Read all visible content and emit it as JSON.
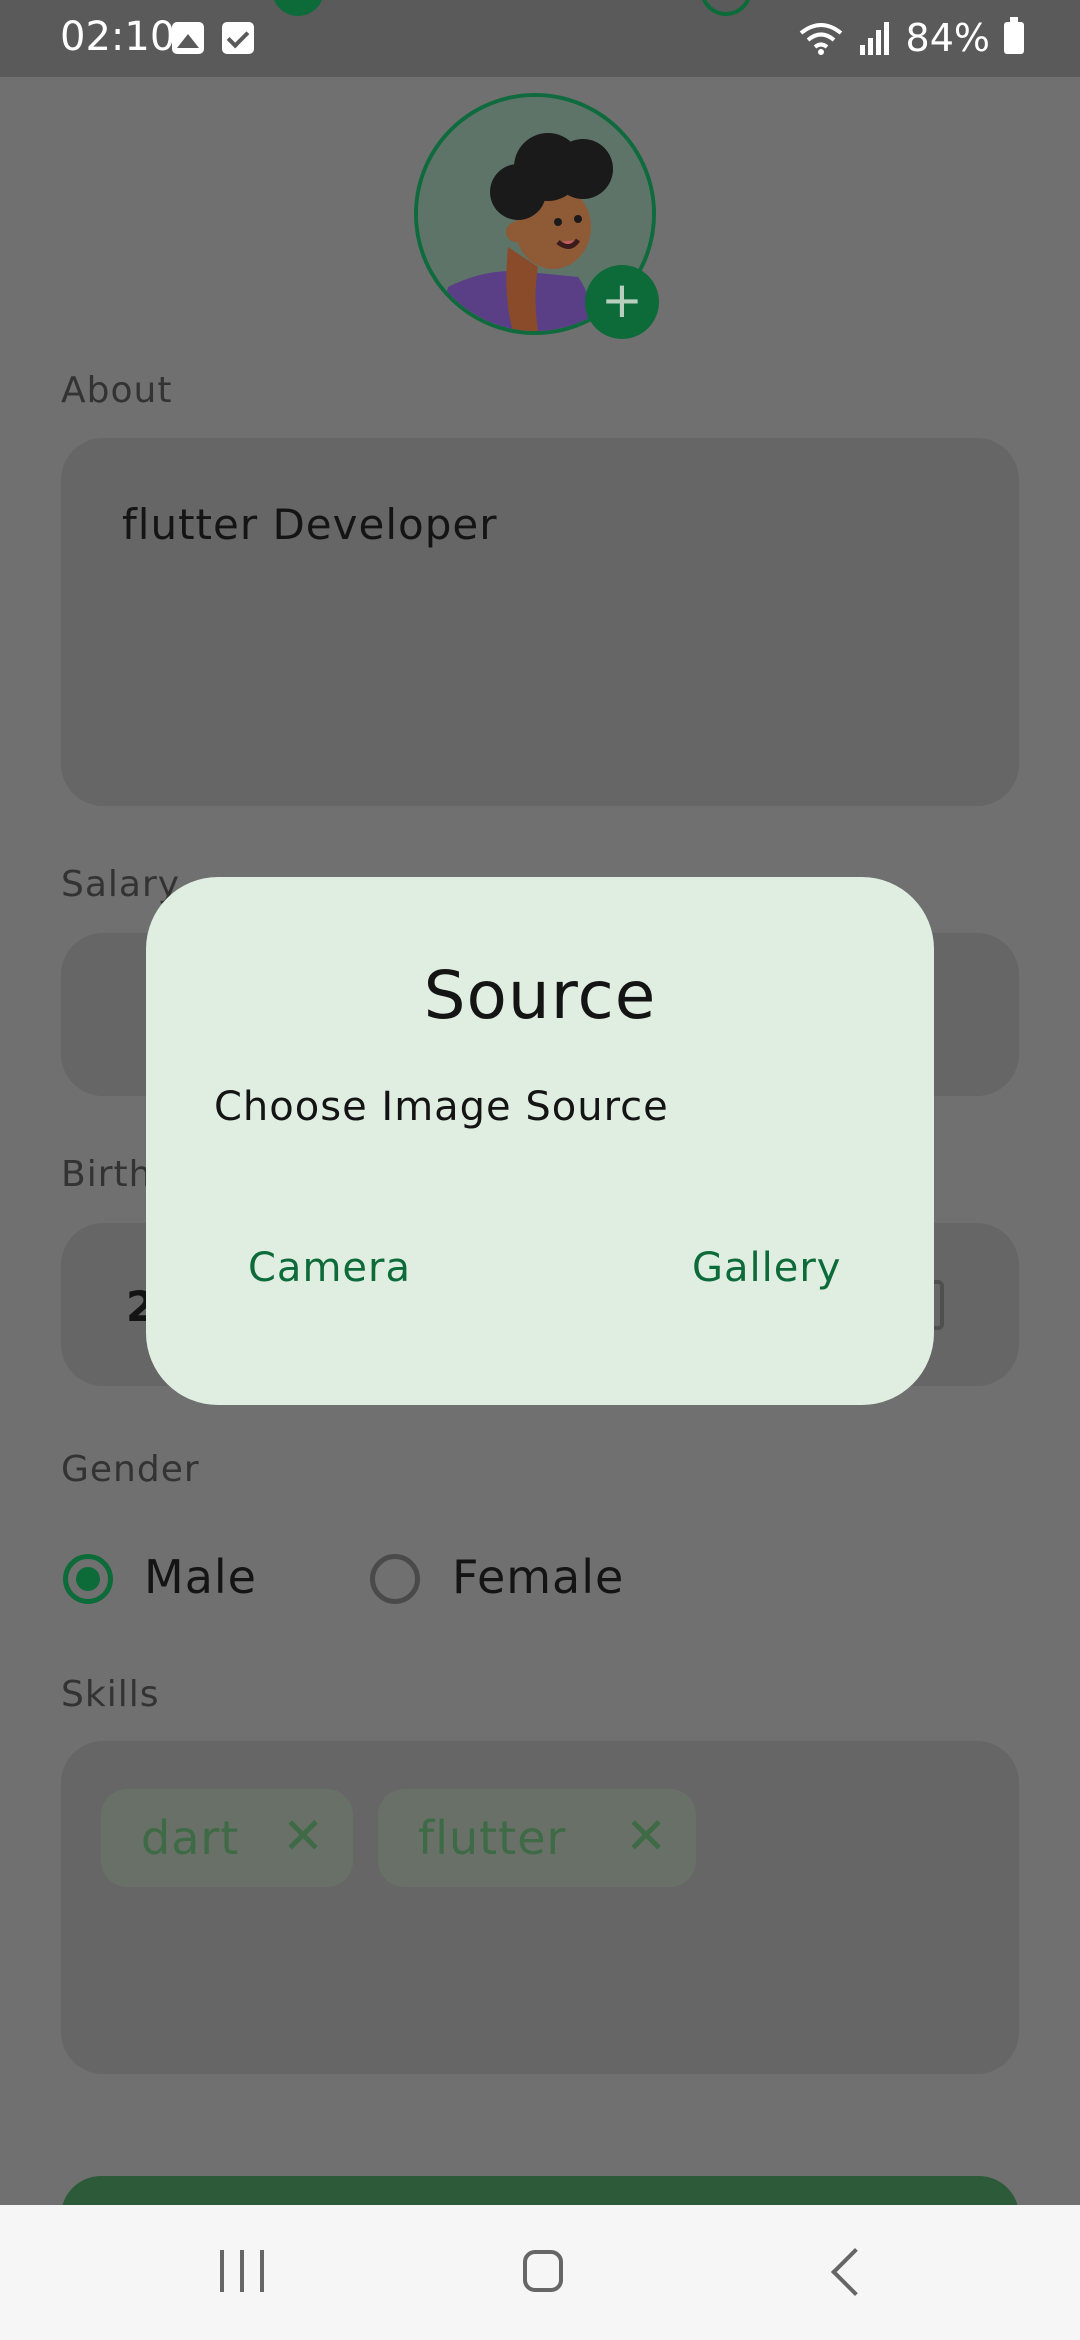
{
  "status_bar": {
    "time": "02:10",
    "battery": "84%",
    "icons": [
      "image-icon",
      "checkbox-icon",
      "wifi-icon",
      "signal-icon",
      "battery-icon"
    ]
  },
  "form": {
    "about_label": "About",
    "about_value": "flutter Developer",
    "salary_label": "Salary",
    "birth_label_visible": "Birth",
    "birth_value_visible": "2",
    "gender_label": "Gender",
    "gender_options": [
      "Male",
      "Female"
    ],
    "gender_selected": "Male",
    "skills_label": "Skills",
    "skills": [
      "dart",
      "flutter"
    ]
  },
  "dialog": {
    "title": "Source",
    "message": "Choose Image Source",
    "camera_label": "Camera",
    "gallery_label": "Gallery"
  },
  "colors": {
    "accent": "#0d6b3a",
    "dialog_bg": "#e0eee2",
    "scrim": "#707070"
  }
}
